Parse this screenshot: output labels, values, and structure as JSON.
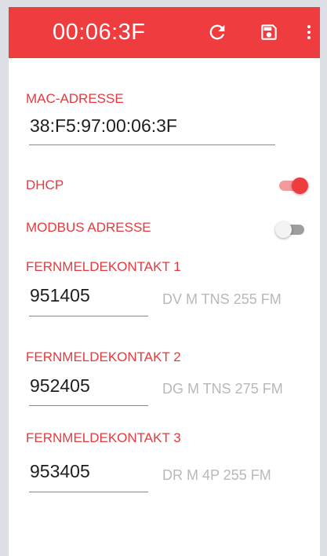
{
  "colors": {
    "accent": "#ef3c3f",
    "label": "#e53a3d",
    "hint": "#b8b8b8",
    "background": "#dcdfe4"
  },
  "appbar": {
    "title": "00:06:3F",
    "refresh_icon": "refresh-icon",
    "save_icon": "floppy-disk-icon",
    "more_icon": "more-vert-icon"
  },
  "mac": {
    "label": "MAC-ADRESSE",
    "value": "38:F5:97:00:06:3F"
  },
  "dhcp": {
    "label": "DHCP",
    "enabled": true
  },
  "modbus": {
    "label": "MODBUS ADRESSE",
    "enabled": false
  },
  "contacts": [
    {
      "label": "FERNMELDEKONTAKT 1",
      "value": "951405",
      "hint": "DV M TNS 255 FM"
    },
    {
      "label": "FERNMELDEKONTAKT 2",
      "value": "952405",
      "hint": "DG M TNS 275 FM"
    },
    {
      "label": "FERNMELDEKONTAKT 3",
      "value": "953405",
      "hint": "DR M 4P 255 FM"
    }
  ]
}
